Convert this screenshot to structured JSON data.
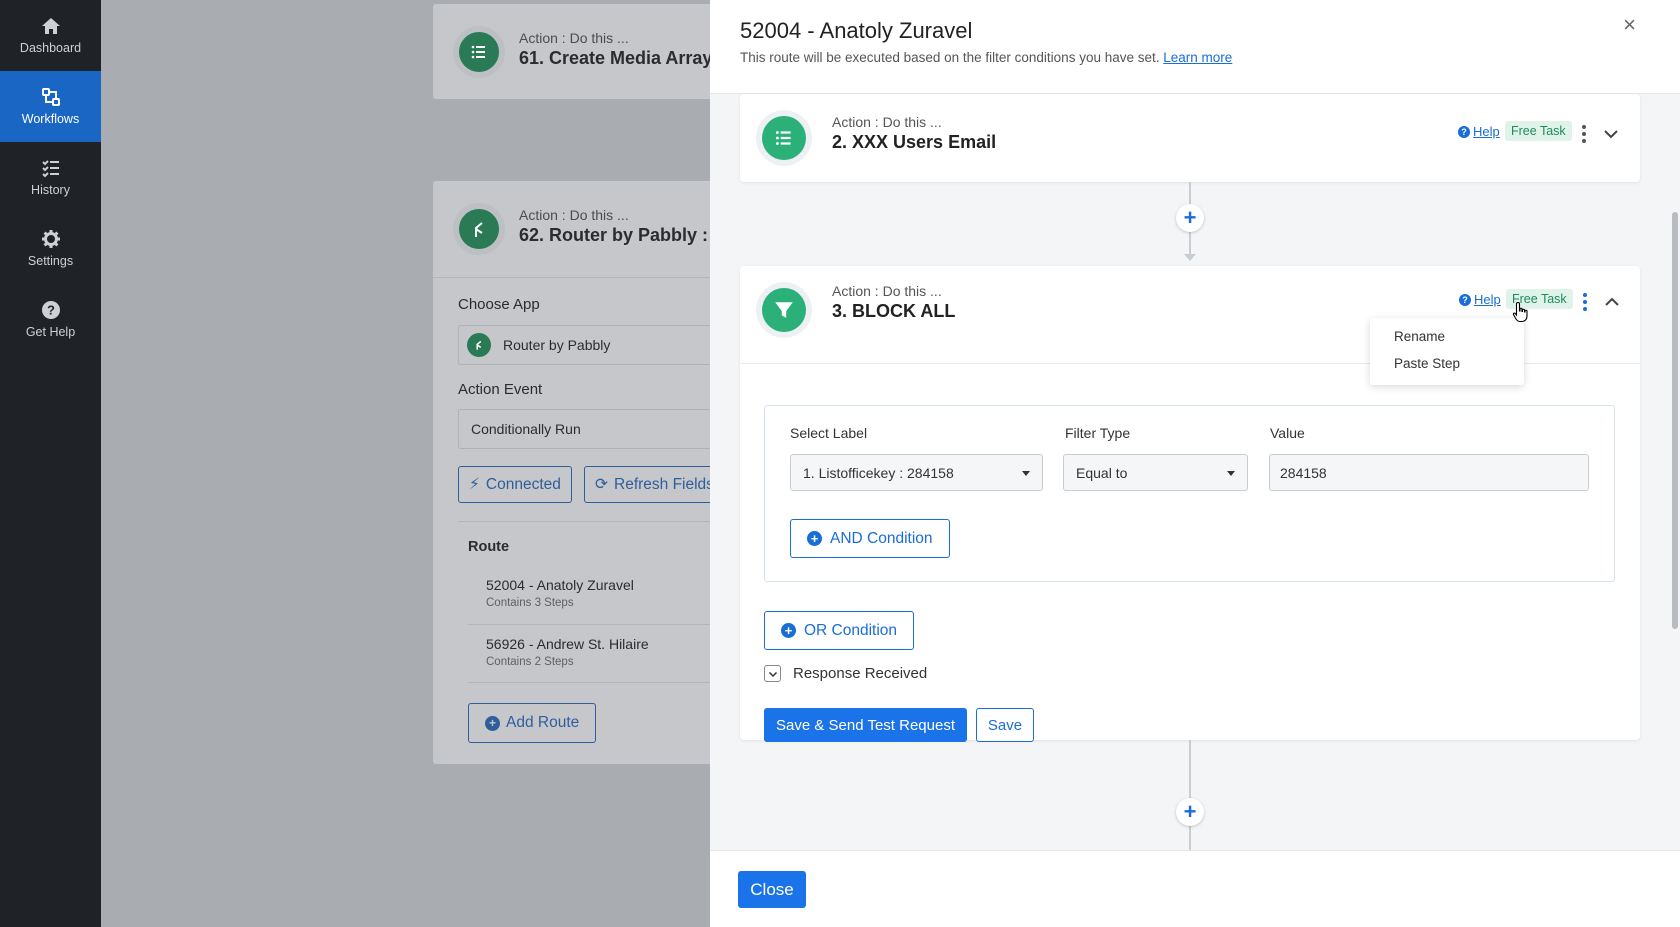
{
  "sidebar": {
    "items": [
      {
        "label": "Dashboard",
        "icon": "home-icon"
      },
      {
        "label": "Workflows",
        "icon": "workflows-icon",
        "active": true
      },
      {
        "label": "History",
        "icon": "history-icon"
      },
      {
        "label": "Settings",
        "icon": "gear-icon"
      },
      {
        "label": "Get Help",
        "icon": "help-icon"
      }
    ]
  },
  "background": {
    "card1": {
      "subtitle": "Action : Do this ...",
      "title": "61. Create Media Array"
    },
    "card2": {
      "subtitle": "Action : Do this ...",
      "title": "62. Router by Pabbly :",
      "choose_app_label": "Choose App",
      "choose_app_value": "Router by Pabbly",
      "action_event_label": "Action Event",
      "action_event_value": "Conditionally Run",
      "connected_label": "Connected",
      "refresh_label": "Refresh Fields",
      "route_heading": "Route",
      "routes": [
        {
          "name": "52004 - Anatoly Zuravel",
          "steps": "Contains 3 Steps"
        },
        {
          "name": "56926 - Andrew St. Hilaire",
          "steps": "Contains 2 Steps"
        }
      ],
      "add_route_label": "Add Route"
    }
  },
  "panel": {
    "title": "52004 - Anatoly Zuravel",
    "subtitle": "This route will be executed based on the filter conditions you have set.",
    "learn_more": "Learn more",
    "close_x": "×",
    "step2": {
      "subtitle": "Action : Do this ...",
      "title": "2. XXX Users Email",
      "help": "Help",
      "badge": "Free Task"
    },
    "step3": {
      "subtitle": "Action : Do this ...",
      "title": "3. BLOCK ALL",
      "help": "Help",
      "badge": "Free Task",
      "filter": {
        "select_label_heading": "Select Label",
        "select_label_value": "1. Listofficekey : 284158",
        "filter_type_heading": "Filter Type",
        "filter_type_value": "Equal to",
        "value_heading": "Value",
        "value_value": "284158",
        "and_condition": "AND Condition"
      },
      "or_condition": "OR Condition",
      "response_received": "Response Received",
      "save_send": "Save & Send Test Request",
      "save": "Save"
    },
    "menu": {
      "rename": "Rename",
      "paste_step": "Paste Step"
    },
    "close_button": "Close"
  },
  "colors": {
    "brand_blue": "#1a73e8",
    "step_green": "#2bb07a",
    "sidebar_bg": "#1f2227",
    "sidebar_active": "#1a66c4"
  }
}
